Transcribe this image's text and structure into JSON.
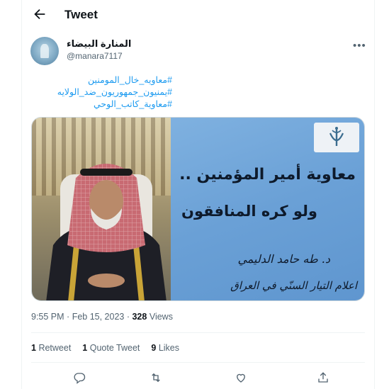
{
  "header": {
    "title": "Tweet"
  },
  "author": {
    "display_name": "المنارة البيضاء",
    "handle": "@manara7117"
  },
  "tweet": {
    "hashtags": [
      "#معاويه_خال_المومنين",
      "#يمنيون_جمهوريون_ضد_الولايه",
      "#معاوية_كاتب_الوحي"
    ],
    "image": {
      "line1": "معاوية أمير المؤمنين ..",
      "line2": "ولو كره المنافقون",
      "line3": "د. طه حامد الدليمي",
      "line4": "اعلام التيار السنّي في العراق"
    },
    "time": "9:55 PM",
    "date": "Feb 15, 2023",
    "views_count": "328",
    "views_label": "Views"
  },
  "stats": {
    "retweets_count": "1",
    "retweets_label": "Retweet",
    "quotes_count": "1",
    "quotes_label": "Quote Tweet",
    "likes_count": "9",
    "likes_label": "Likes"
  },
  "colors": {
    "link": "#1d9bf0",
    "secondary": "#536471",
    "panel_blue": "#6aa0d6"
  }
}
